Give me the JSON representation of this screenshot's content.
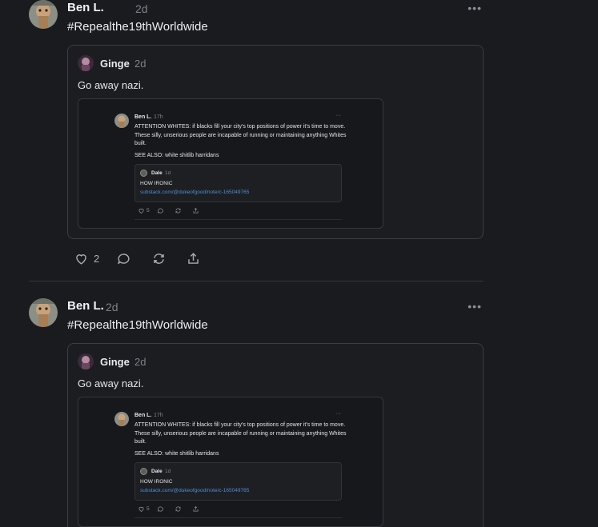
{
  "posts": [
    {
      "author": "Ben L.",
      "time": "2d",
      "more": "•••",
      "text": "#Repealthe19thWorldwide",
      "quote": {
        "author": "Ginge",
        "time": "2d",
        "text": "Go away nazi.",
        "screenshot": {
          "author": "Ben L.",
          "time": "17h",
          "more": "···",
          "text": "ATTENTION WHITES: if blacks fill your city's top positions of power it's time to move.  These silly, unserious people are incapable of running or maintaining anything Whites built.",
          "also": "SEE ALSO: white shitlib harridans",
          "inner": {
            "author": "Dale",
            "time": "1d",
            "text": "HOW IRONIC",
            "link": "substack.com/@dukeofgood/note/c-165049765"
          },
          "likes": "5"
        }
      },
      "likes": "2"
    },
    {
      "author": "Ben L.",
      "time": "2d",
      "more": "•••",
      "text": "#Repealthe19thWorldwide",
      "quote": {
        "author": "Ginge",
        "time": "2d",
        "text": "Go away nazi.",
        "screenshot": {
          "author": "Ben L.",
          "time": "17h",
          "more": "···",
          "text": "ATTENTION WHITES: if blacks fill your city's top positions of power it's time to move.  These silly, unserious people are incapable of running or maintaining anything Whites built.",
          "also": "SEE ALSO: white shitlib harridans",
          "inner": {
            "author": "Dale",
            "time": "1d",
            "text": "HOW IRONIC",
            "link": "substack.com/@dukeofgood/note/c-165049765"
          },
          "likes": "5"
        }
      }
    }
  ],
  "icons": {
    "like": "heart-icon",
    "comment": "comment-icon",
    "restack": "restack-icon",
    "share": "share-icon",
    "more": "more-icon"
  },
  "colors": {
    "background": "#191b1f",
    "link": "#4f8fd6",
    "muted": "#7d8288",
    "border": "#3a3d42"
  }
}
